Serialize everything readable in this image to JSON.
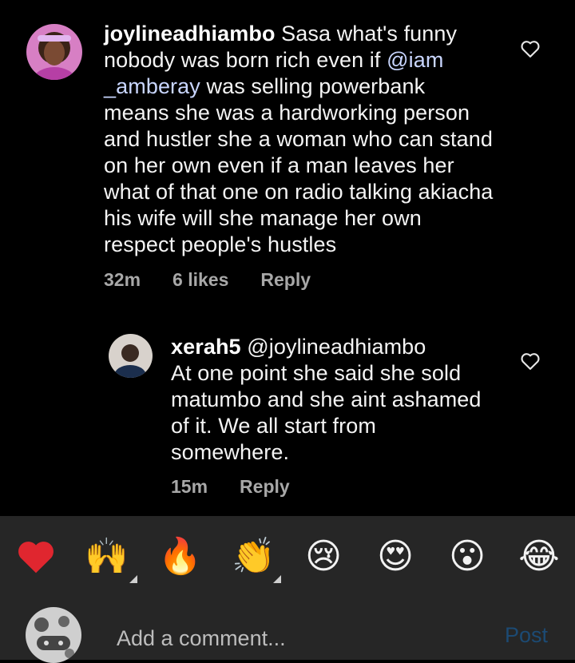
{
  "comments": [
    {
      "username": "joylineadhiambo",
      "text_before": " Sasa what's funny nobody was born rich even if ",
      "mention": "@iam _amberay",
      "text_after": " was selling powerbank means she was a hardworking person and hustler she a woman who can stand on her own even if a man leaves her what of that one on radio talking akiacha his wife will she manage her own respect people's hustles",
      "time": "32m",
      "likes": "6 likes",
      "reply_label": "Reply"
    },
    {
      "username": "xerah5",
      "mention": " @joylineadhiambo",
      "text": "At one point she said she sold matumbo and she aint ashamed of it. We all start from somewhere.",
      "time": "15m",
      "reply_label": "Reply"
    }
  ],
  "emoji_bar": [
    {
      "name": "red-heart",
      "char": "❤️"
    },
    {
      "name": "raising-hands",
      "char": "🙌"
    },
    {
      "name": "fire",
      "char": "🔥"
    },
    {
      "name": "clapping-hands",
      "char": "👏"
    },
    {
      "name": "crying-face",
      "char": "😢"
    },
    {
      "name": "heart-eyes",
      "char": "😍"
    },
    {
      "name": "astonished-face",
      "char": "😮"
    },
    {
      "name": "tears-of-joy",
      "char": "😂"
    }
  ],
  "composer": {
    "placeholder": "Add a comment...",
    "post_label": "Post"
  },
  "colors": {
    "background": "#000000",
    "composer_bg": "#262626",
    "post_disabled": "#1c4a73",
    "meta": "#a8a8a8"
  }
}
